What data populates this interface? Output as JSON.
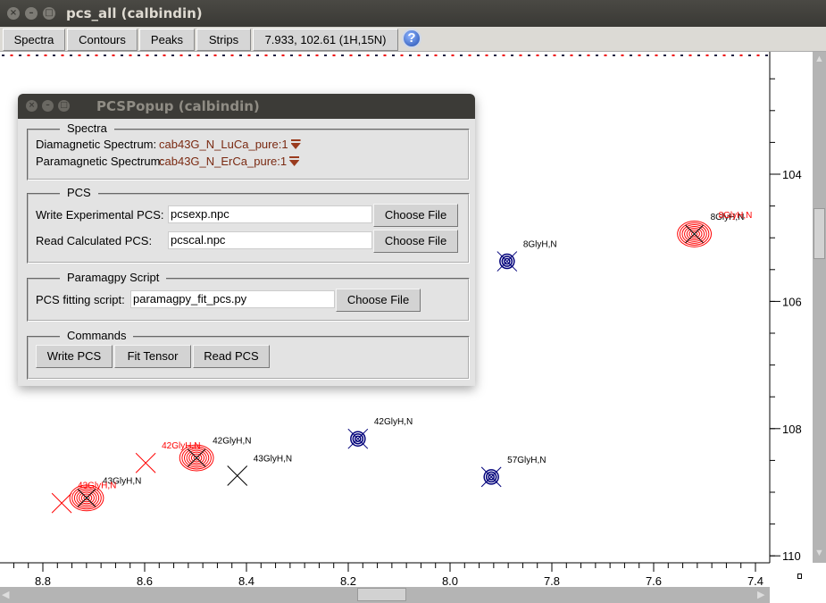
{
  "window": {
    "title": "pcs_all (calbindin)"
  },
  "toolbar": {
    "spectra": "Spectra",
    "contours": "Contours",
    "peaks": "Peaks",
    "strips": "Strips",
    "cursor_readout": "7.933, 102.61 (1H,15N)",
    "help": "?"
  },
  "plot": {
    "x_ticks": [
      "8.8",
      "8.6",
      "8.4",
      "8.2",
      "8.0",
      "7.8",
      "7.6",
      "7.4"
    ],
    "y_ticks": [
      "104",
      "106",
      "108",
      "110"
    ],
    "x_range": [
      8.8,
      7.4
    ],
    "y_range": [
      104,
      110
    ],
    "colors": {
      "diamagnetic": "#00007a",
      "paramagnetic": "#ff0000",
      "label": "#000000"
    },
    "peaks": [
      {
        "x": 7.888,
        "y": 105.37,
        "type": "blue",
        "label": "8GlyH,N",
        "lc": "black"
      },
      {
        "x": 7.52,
        "y": 104.94,
        "type": "redcontour",
        "label": "8GlyH,N",
        "lc": "black",
        "label2": "8GlyH,N"
      },
      {
        "x": 8.181,
        "y": 108.16,
        "type": "blue",
        "label": "42GlyH,N",
        "lc": "black"
      },
      {
        "x": 7.919,
        "y": 108.76,
        "type": "blue",
        "label": "57GlyH,N",
        "lc": "black"
      },
      {
        "x": 8.498,
        "y": 108.46,
        "type": "redcontour",
        "label": "42GlyH,N",
        "lc": "black"
      },
      {
        "x": 8.418,
        "y": 108.74,
        "type": "blackx",
        "label": "43GlyH,N",
        "lc": "black"
      },
      {
        "x": 8.598,
        "y": 108.54,
        "type": "redx",
        "label": "42GlyH,N",
        "lc": "red"
      },
      {
        "x": 8.714,
        "y": 109.09,
        "type": "redcontour",
        "label": "43GlyH,N",
        "lc": "black",
        "label2": "43GlyH,N"
      },
      {
        "x": 8.763,
        "y": 109.17,
        "type": "redx",
        "label": "",
        "lc": "red"
      }
    ]
  },
  "popup": {
    "title": "PCSPopup (calbindin)",
    "spectra": {
      "legend": "Spectra",
      "dia_label": "Diamagnetic Spectrum:",
      "dia_value": "cab43G_N_LuCa_pure:1",
      "para_label": "Paramagnetic Spectrum:",
      "para_value": "cab43G_N_ErCa_pure:1"
    },
    "pcs": {
      "legend": "PCS",
      "write_label": "Write Experimental PCS:",
      "write_value": "pcsexp.npc",
      "read_label": "Read Calculated PCS:",
      "read_value": "pcscal.npc",
      "choose": "Choose File"
    },
    "script": {
      "legend": "Paramagpy Script",
      "label": "PCS fitting script:",
      "value": "paramagpy_fit_pcs.py",
      "choose": "Choose File"
    },
    "commands": {
      "legend": "Commands",
      "write": "Write PCS",
      "fit": "Fit Tensor",
      "read": "Read PCS"
    }
  }
}
